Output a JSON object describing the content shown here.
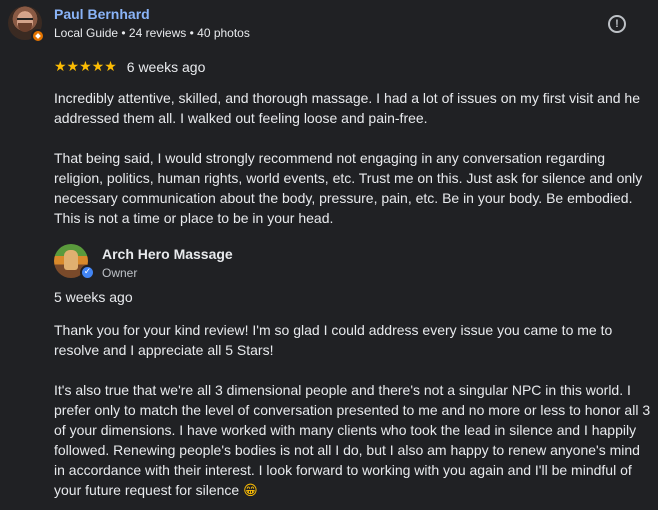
{
  "review": {
    "reviewer_name": "Paul Bernhard",
    "reviewer_meta": "Local Guide • 24 reviews • 40 photos",
    "rating": 5,
    "stars": "★★★★★",
    "date": "6 weeks ago",
    "report_icon": "!",
    "paragraphs": [
      "Incredibly attentive, skilled, and thorough massage. I had a lot of issues on my first visit and he addressed them all. I walked out feeling loose and pain-free.",
      "That being said, I would strongly recommend not engaging in any conversation regarding religion, politics, human rights, world events, etc. Trust me on this. Just ask for silence and only necessary communication about the body, pressure, pain, etc. Be in your body. Be embodied. This is not a time or place to be in your head."
    ]
  },
  "response": {
    "owner_name": "Arch Hero Massage",
    "owner_role": "Owner",
    "verified_icon": "✓",
    "date": "5 weeks ago",
    "paragraphs": [
      "Thank you for your kind review! I'm so glad I could address every issue you came to me to resolve and I appreciate all 5 Stars!",
      "It's also true that we're all 3 dimensional people and there's not a singular NPC in this world. I prefer only to match the level of conversation presented to me and no more or less to honor all 3 of your dimensions. I have worked with many clients who took the lead in silence and I happily followed. Renewing people's bodies is not all I do, but I also am happy to renew anyone's mind in accordance with their interest. I look forward to working with you again and I'll be mindful of your future request for silence"
    ],
    "emoji": "😁"
  },
  "colors": {
    "background": "#202124",
    "link": "#8ab4f8",
    "star": "#fbbc04",
    "text": "#e8eaed",
    "guide_badge": "#e37400",
    "verified": "#4285f4"
  }
}
